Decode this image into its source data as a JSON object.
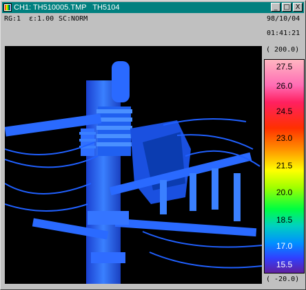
{
  "window": {
    "title": "CH1: TH510005.TMP   TH5104",
    "controls": [
      "_",
      "□",
      "X"
    ]
  },
  "info": {
    "rg": "RG:1",
    "emissivity": "ε:1.00",
    "sc": "SC:NORM",
    "date": "98/10/04",
    "time": "01:41:21"
  },
  "scale": {
    "max_range": "( 200.0)",
    "min_range": "( -20.0)",
    "ticks": [
      "27.5",
      "26.0",
      "24.5",
      "23.0",
      "21.5",
      "20.0",
      "18.5",
      "17.0",
      "15.5"
    ]
  },
  "colors": {
    "titlebar": "#00807f",
    "window": "#c0c0c0",
    "thermal_bg": "#000000",
    "object": "#1e60ff"
  }
}
